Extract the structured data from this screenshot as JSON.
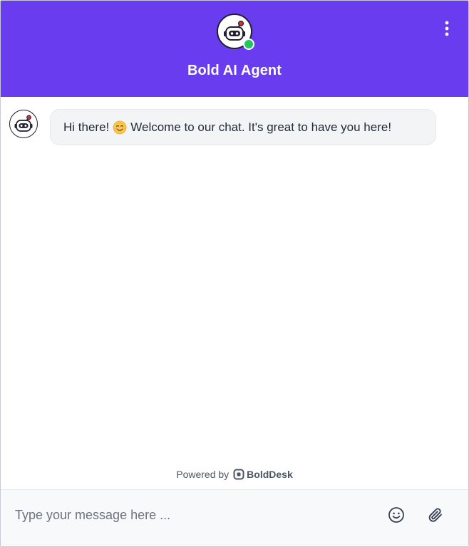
{
  "header": {
    "title": "Bold AI Agent",
    "status": "online",
    "icons": {
      "avatar": "robot-icon",
      "menu": "more-vertical-icon"
    }
  },
  "messages": [
    {
      "sender": "bot",
      "text_before": "Hi there!",
      "emoji": "smiling-face-emoji",
      "text_after": "Welcome to our chat. It's great to have you here!"
    }
  ],
  "footer": {
    "powered_by": "Powered by",
    "brand": "BoldDesk"
  },
  "composer": {
    "placeholder": "Type your message here ...",
    "value": "",
    "icons": {
      "emoji": "emoji-icon",
      "attach": "paperclip-icon"
    }
  },
  "colors": {
    "header_bg": "#6a3cef",
    "status_online": "#22c55e",
    "bubble_bg": "#f3f4f6",
    "composer_bg": "#f8f9fb"
  }
}
